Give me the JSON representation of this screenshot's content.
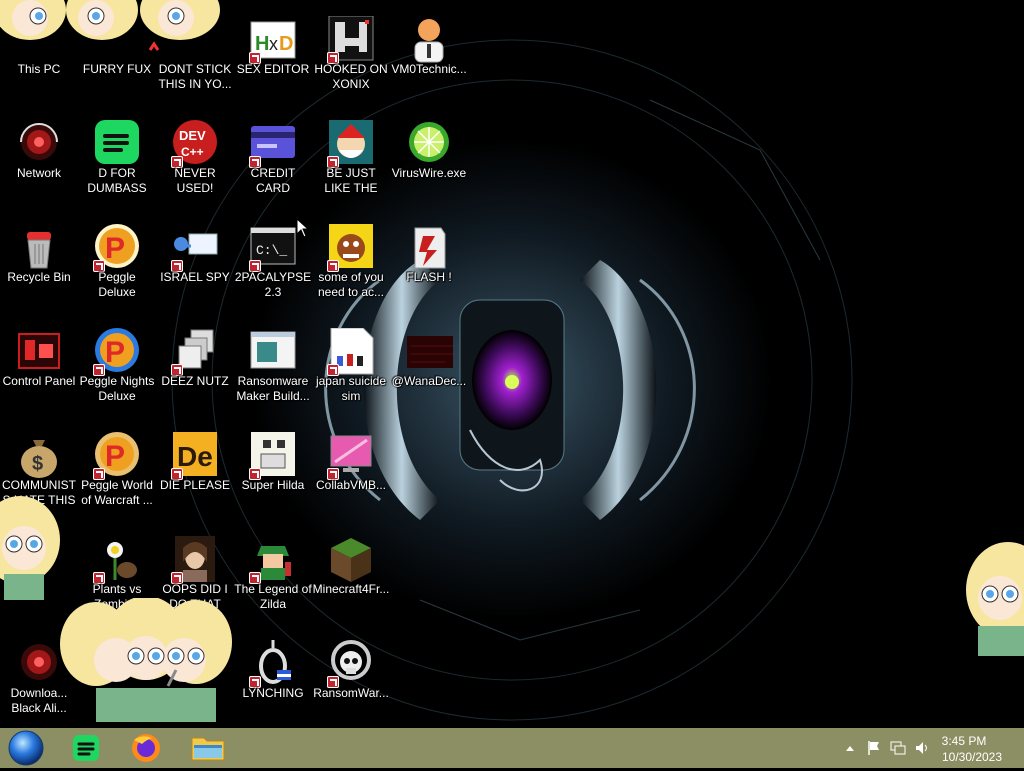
{
  "desktop": {
    "icons": [
      {
        "label": "This PC",
        "icon": "this-pc-icon"
      },
      {
        "label": "FURRY FUX",
        "icon": "app-icon"
      },
      {
        "label": "DONT STICK THIS IN YO...",
        "icon": "app-icon"
      },
      {
        "label": "SEX EDITOR",
        "icon": "hxd-icon"
      },
      {
        "label": "HOOKED ON XONIX",
        "icon": "xonix-icon"
      },
      {
        "label": "VM0Technic...",
        "icon": "doctor-icon"
      },
      {
        "label": "Network",
        "icon": "network-icon"
      },
      {
        "label": "D FOR DUMBASS",
        "icon": "spotify-icon"
      },
      {
        "label": "NEVER USED!",
        "icon": "devcpp-icon"
      },
      {
        "label": "CREDIT CARD CHECKER",
        "icon": "credit-card-icon"
      },
      {
        "label": "BE JUST LIKE THE DUDE!",
        "icon": "santa-icon"
      },
      {
        "label": "VirusWire.exe",
        "icon": "lime-icon"
      },
      {
        "label": "Recycle Bin",
        "icon": "recycle-bin-icon"
      },
      {
        "label": "Peggle Deluxe",
        "icon": "peggle-icon"
      },
      {
        "label": "ISRAEL SPY",
        "icon": "spy-icon"
      },
      {
        "label": "2PACALYPSE 2.3",
        "icon": "terminal-icon"
      },
      {
        "label": "some of you need to ac...",
        "icon": "dog-icon"
      },
      {
        "label": "FLASH !",
        "icon": "flash-icon"
      },
      {
        "label": "Control Panel",
        "icon": "control-panel-icon"
      },
      {
        "label": "Peggle Nights Deluxe",
        "icon": "peggle-icon"
      },
      {
        "label": "DEEZ NUTZ",
        "icon": "windows-stack-icon"
      },
      {
        "label": "Ransomware Maker Build...",
        "icon": "window-icon"
      },
      {
        "label": "japan suicide sim",
        "icon": "document-icon"
      },
      {
        "label": "@WanaDec...",
        "icon": "wanadec-icon"
      },
      {
        "label": "COMMUNISTS HATE THIS G...",
        "icon": "money-bag-icon"
      },
      {
        "label": "Peggle World of Warcraft ...",
        "icon": "peggle-icon"
      },
      {
        "label": "DIE PLEASE",
        "icon": "de-icon"
      },
      {
        "label": "Super Hilda",
        "icon": "pixel-icon"
      },
      {
        "label": "CollabVMB...",
        "icon": "monitor-icon"
      },
      {
        "label": "Plants vs Zombies",
        "icon": "flower-icon"
      },
      {
        "label": "OOPS DID I DO THAT",
        "icon": "portrait-icon"
      },
      {
        "label": "The Legend of Zilda",
        "icon": "link-icon"
      },
      {
        "label": "Minecraft4Fr...",
        "icon": "minecraft-icon"
      },
      {
        "label": "Downloa... Black Ali...",
        "icon": "network-icon"
      },
      {
        "label": "LYNCHING",
        "icon": "noose-icon"
      },
      {
        "label": "RansomWar...",
        "icon": "skull-icon"
      }
    ]
  },
  "taskbar": {
    "apps": [
      "start-orb-icon",
      "spotify-icon",
      "firefox-icon",
      "file-explorer-icon"
    ],
    "tray_icons": [
      "chevron-up-icon",
      "flag-icon",
      "network-tray-icon",
      "volume-icon"
    ],
    "time": "3:45 PM",
    "date": "10/30/2023"
  },
  "colors": {
    "taskbar": "#8c8f63",
    "wallpaper": "#000000",
    "accent_glow": "#7fe0ff"
  }
}
